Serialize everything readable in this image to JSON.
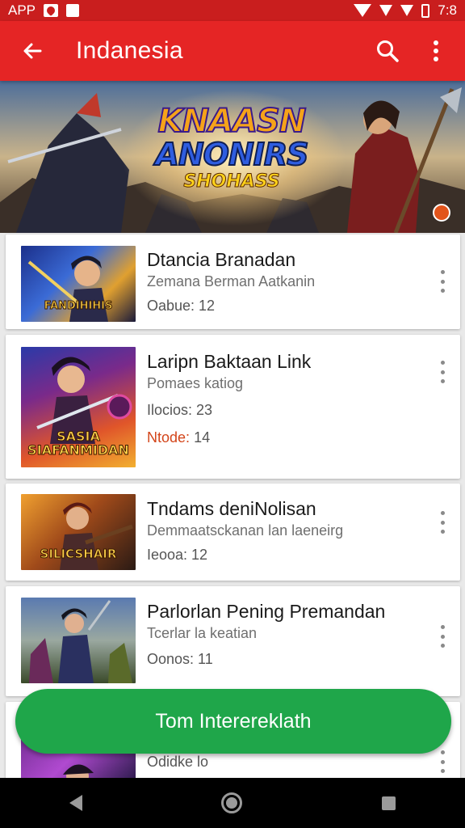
{
  "status_bar": {
    "left_label": "APP",
    "time": "7:8"
  },
  "app_bar": {
    "title": "Indanesia"
  },
  "banner": {
    "line1": "KNAASN",
    "line2": "ANONIRS",
    "line3": "SHOHASS"
  },
  "items": [
    {
      "title": "Dtancia Branadan",
      "subtitle": "Zemana Berman Aatkanin",
      "meta1": "Oabue: 12",
      "thumb_caption": "FANDIHIHIS"
    },
    {
      "title": "Laripn Baktaan Link",
      "subtitle": "Pomaes katiog",
      "meta1": "Ilocios: 23",
      "meta2_label": "Ntode:",
      "meta2_value": "14",
      "thumb_caption": "SASIA SIAFANMIDAN"
    },
    {
      "title": "Tndams deniNolisan",
      "subtitle": "Demmaatsckanan lan laeneirg",
      "meta1": "Ieooa: 12",
      "thumb_caption": "SILICSHAIR"
    },
    {
      "title": "Parlorlan Pening Premandan",
      "subtitle": "Tcerlar la keatian",
      "meta1": "Oonos: 11",
      "thumb_caption": ""
    },
    {
      "title": "",
      "subtitle": "",
      "meta1": "Odidke lo",
      "thumb_caption": ""
    }
  ],
  "fab": {
    "label": "Tom Interereklath"
  },
  "colors": {
    "status_bar": "#c91e1e",
    "app_bar": "#e52525",
    "fab": "#1fa64a",
    "accent_meta": "#d3451a"
  }
}
